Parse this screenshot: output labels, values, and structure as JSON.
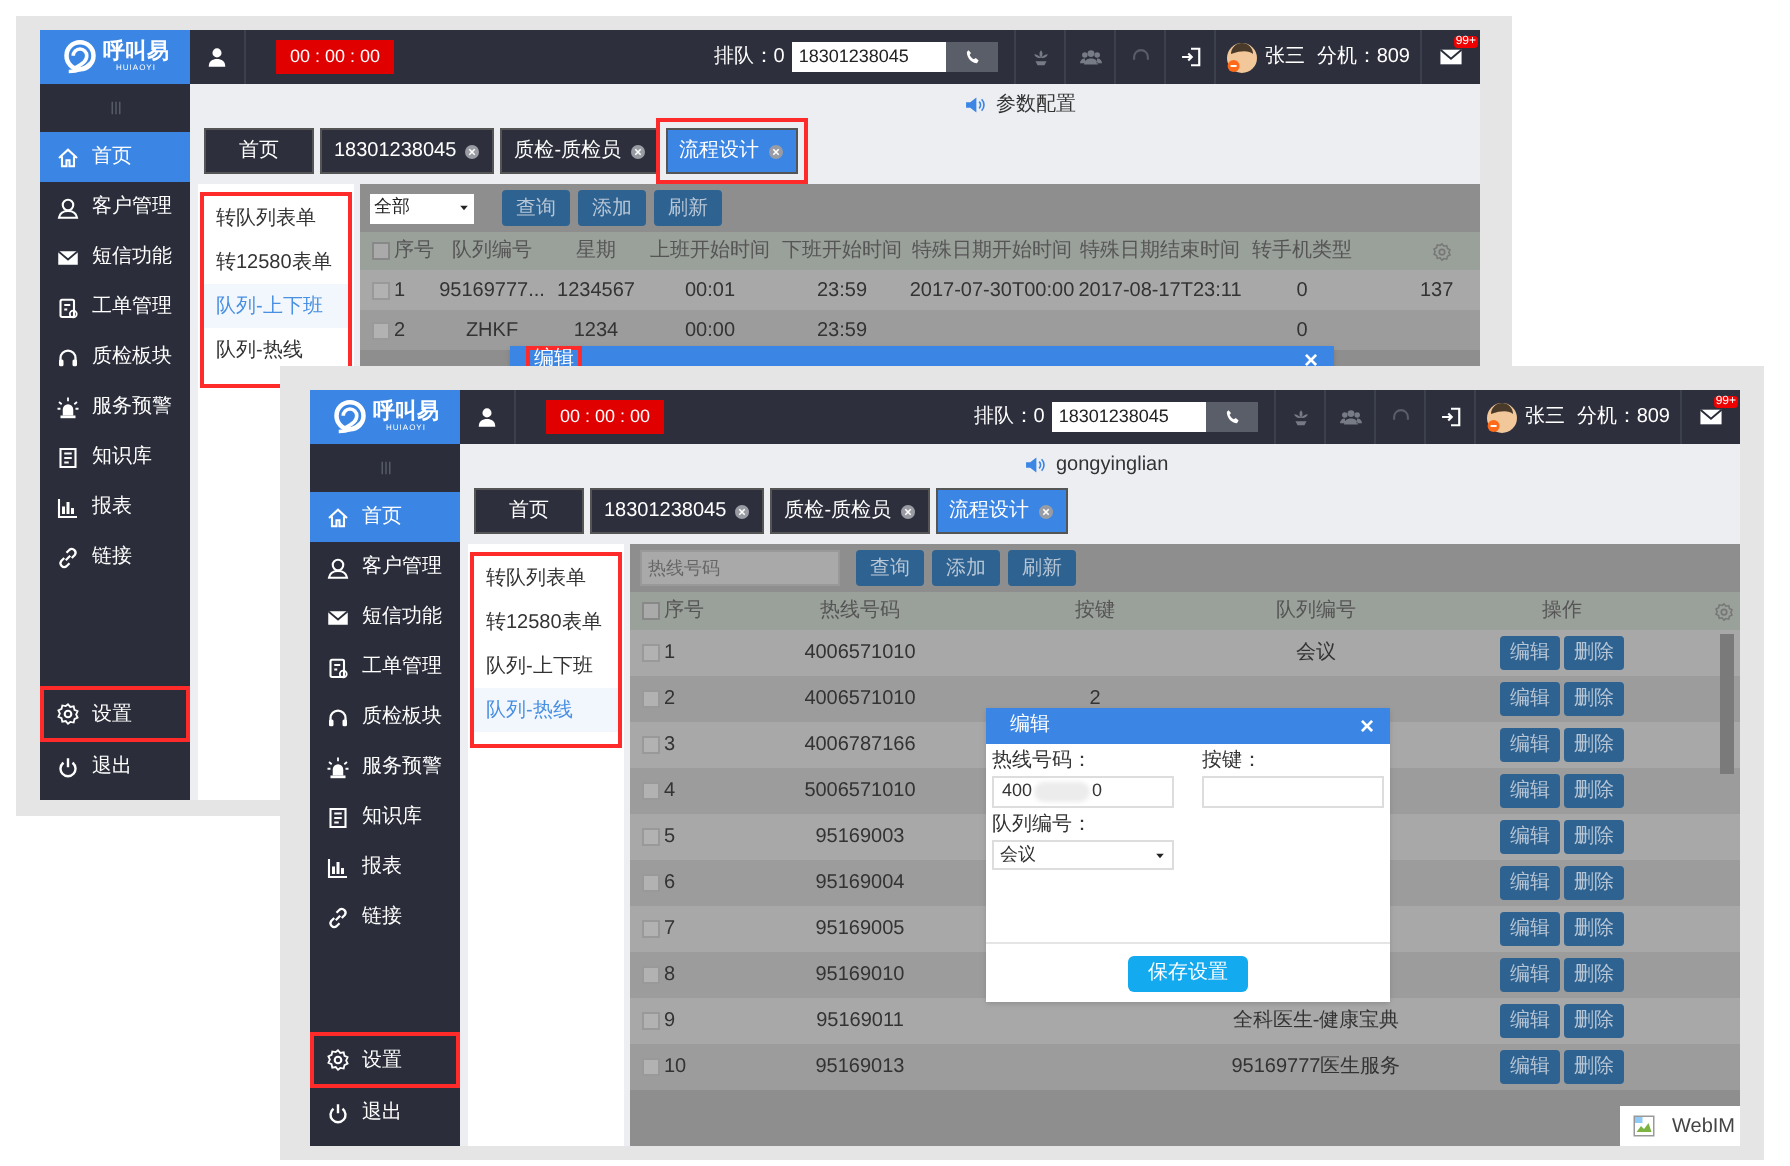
{
  "back_screen": {
    "logo": {
      "name": "呼叫易",
      "subtitle": "HUIAOYI"
    },
    "header": {
      "timer": "00 : 00 : 00",
      "queue": "排队：0",
      "phone_value": "18301238045",
      "user_name": "张三",
      "extension": "分机：809",
      "mail_badge": "99+"
    },
    "sidebar": {
      "items": [
        {
          "label": "首页",
          "selected": true,
          "highlighted": false
        },
        {
          "label": "客户管理",
          "selected": false,
          "highlighted": false
        },
        {
          "label": "短信功能",
          "selected": false,
          "highlighted": false
        },
        {
          "label": "工单管理",
          "selected": false,
          "highlighted": false
        },
        {
          "label": "质检板块",
          "selected": false,
          "highlighted": false
        },
        {
          "label": "服务预警",
          "selected": false,
          "highlighted": false
        },
        {
          "label": "知识库",
          "selected": false,
          "highlighted": false
        },
        {
          "label": "报表",
          "selected": false,
          "highlighted": false
        },
        {
          "label": "链接",
          "selected": false,
          "highlighted": false
        }
      ],
      "bottom_items": [
        {
          "label": "设置",
          "selected": false,
          "highlighted": true
        },
        {
          "label": "退出",
          "selected": false,
          "highlighted": false
        }
      ]
    },
    "notice": "参数配置",
    "tabs": [
      {
        "label": "首页",
        "closable": false,
        "selected": false,
        "highlighted": false
      },
      {
        "label": "18301238045",
        "closable": true,
        "selected": false,
        "highlighted": false
      },
      {
        "label": "质检-质检员",
        "closable": true,
        "selected": false,
        "highlighted": false
      },
      {
        "label": "流程设计",
        "closable": true,
        "selected": true,
        "highlighted": true
      }
    ],
    "submenu": {
      "highlighted": true,
      "items": [
        {
          "label": "转队列表单",
          "selected": false
        },
        {
          "label": "转12580表单",
          "selected": false
        },
        {
          "label": "队列-上下班",
          "selected": true
        },
        {
          "label": "队列-热线",
          "selected": false
        }
      ]
    },
    "toolbar": {
      "filter": {
        "kind": "select",
        "value": "全部"
      },
      "buttons": [
        "查询",
        "添加",
        "刷新"
      ]
    },
    "table": {
      "header_checked": false,
      "columns": [
        "序号",
        "队列编号",
        "星期",
        "上班开始时间",
        "下班开始时间",
        "特殊日期开始时间",
        "特殊日期结束时间",
        "转手机类型"
      ],
      "rows": [
        {
          "checked": false,
          "cells": [
            "1",
            "95169777...",
            "1234567",
            "00:01",
            "23:59",
            "2017-07-30T00:00",
            "2017-08-17T23:11",
            "0",
            "137"
          ]
        },
        {
          "checked": false,
          "cells": [
            "2",
            "ZHKF",
            "1234",
            "00:00",
            "23:59",
            null,
            null,
            "0",
            null
          ]
        }
      ]
    },
    "dialog": {
      "title": "编辑",
      "close": "×",
      "title_highlighted": true
    }
  },
  "front_screen": {
    "logo": {
      "name": "呼叫易",
      "subtitle": "HUIAOYI"
    },
    "header": {
      "timer": "00 : 00 : 00",
      "queue": "排队：0",
      "phone_value": "18301238045",
      "user_name": "张三",
      "extension": "分机：809",
      "mail_badge": "99+"
    },
    "sidebar": {
      "items": [
        {
          "label": "首页",
          "selected": true,
          "highlighted": false
        },
        {
          "label": "客户管理",
          "selected": false,
          "highlighted": false
        },
        {
          "label": "短信功能",
          "selected": false,
          "highlighted": false
        },
        {
          "label": "工单管理",
          "selected": false,
          "highlighted": false
        },
        {
          "label": "质检板块",
          "selected": false,
          "highlighted": false
        },
        {
          "label": "服务预警",
          "selected": false,
          "highlighted": false
        },
        {
          "label": "知识库",
          "selected": false,
          "highlighted": false
        },
        {
          "label": "报表",
          "selected": false,
          "highlighted": false
        },
        {
          "label": "链接",
          "selected": false,
          "highlighted": false
        }
      ],
      "bottom_items": [
        {
          "label": "设置",
          "selected": false,
          "highlighted": true
        },
        {
          "label": "退出",
          "selected": false,
          "highlighted": false
        }
      ]
    },
    "notice": "gongyinglian",
    "tabs": [
      {
        "label": "首页",
        "closable": false,
        "selected": false,
        "highlighted": false
      },
      {
        "label": "18301238045",
        "closable": true,
        "selected": false,
        "highlighted": false
      },
      {
        "label": "质检-质检员",
        "closable": true,
        "selected": false,
        "highlighted": false
      },
      {
        "label": "流程设计",
        "closable": true,
        "selected": true,
        "highlighted": false
      }
    ],
    "submenu": {
      "highlighted": true,
      "items": [
        {
          "label": "转队列表单",
          "selected": false
        },
        {
          "label": "转12580表单",
          "selected": false
        },
        {
          "label": "队列-上下班",
          "selected": false
        },
        {
          "label": "队列-热线",
          "selected": true
        }
      ]
    },
    "toolbar": {
      "filter": {
        "kind": "input",
        "placeholder": "热线号码"
      },
      "buttons": [
        "查询",
        "添加",
        "刷新"
      ]
    },
    "table": {
      "header_checked": false,
      "columns": [
        "序号",
        "热线号码",
        "按键",
        "队列编号",
        "操作"
      ],
      "rows": [
        {
          "checked": false,
          "cells": [
            "1",
            "4006571010",
            null,
            "会议"
          ],
          "actions": [
            "编辑",
            "删除"
          ]
        },
        {
          "checked": false,
          "cells": [
            "2",
            "4006571010",
            "2",
            null
          ],
          "actions": [
            "编辑",
            "删除"
          ]
        },
        {
          "checked": false,
          "cells": [
            "3",
            "4006787166",
            null,
            null
          ],
          "actions": [
            "编辑",
            "删除"
          ]
        },
        {
          "checked": false,
          "cells": [
            "4",
            "5006571010",
            null,
            null
          ],
          "actions": [
            "编辑",
            "删除"
          ]
        },
        {
          "checked": false,
          "cells": [
            "5",
            "95169003",
            null,
            null
          ],
          "actions": [
            "编辑",
            "删除"
          ]
        },
        {
          "checked": false,
          "cells": [
            "6",
            "95169004",
            null,
            null
          ],
          "actions": [
            "编辑",
            "删除"
          ]
        },
        {
          "checked": false,
          "cells": [
            "7",
            "95169005",
            null,
            null
          ],
          "actions": [
            "编辑",
            "删除"
          ]
        },
        {
          "checked": false,
          "cells": [
            "8",
            "95169010",
            null,
            null
          ],
          "actions": [
            "编辑",
            "删除"
          ]
        },
        {
          "checked": false,
          "cells": [
            "9",
            "95169011",
            null,
            "全科医生-健康宝典"
          ],
          "actions": [
            "编辑",
            "删除"
          ]
        },
        {
          "checked": false,
          "cells": [
            "10",
            "95169013",
            null,
            "95169777医生服务"
          ],
          "actions": [
            "编辑",
            "删除"
          ]
        }
      ]
    },
    "dialog": {
      "title": "编辑",
      "close": "×",
      "title_highlighted": false,
      "fields": [
        {
          "kind": "masked_input",
          "label": "热线号码：",
          "value_prefix": "400",
          "value_suffix": "0"
        },
        {
          "kind": "input",
          "label": "按键："
        },
        {
          "kind": "select",
          "label": "队列编号：",
          "value": "会议"
        }
      ],
      "save_button": "保存设置"
    },
    "webim": {
      "label": "WebIM"
    }
  }
}
